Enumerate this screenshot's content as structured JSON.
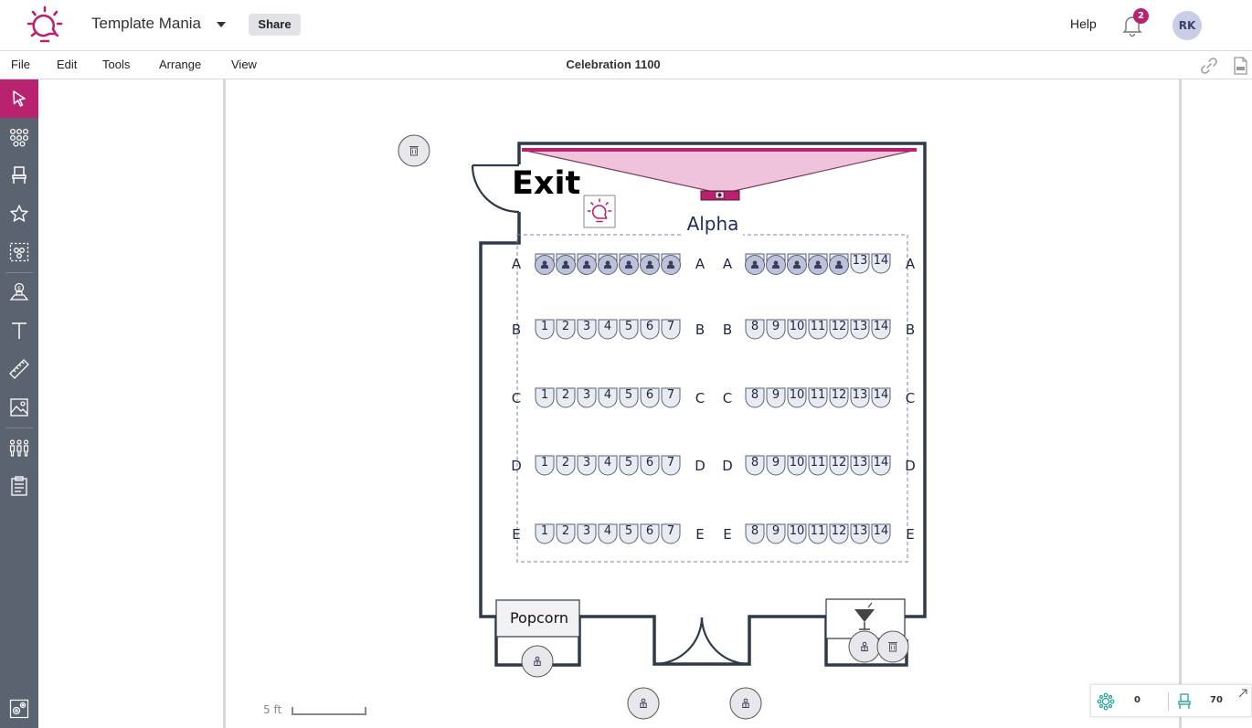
{
  "header": {
    "app_title": "Template Mania",
    "share_label": "Share",
    "help_label": "Help",
    "notification_count": "2",
    "avatar_initials": "RK"
  },
  "menu": {
    "items": [
      "File",
      "Edit",
      "Tools",
      "Arrange",
      "View"
    ],
    "document_title": "Celebration 1100"
  },
  "toolbar": {
    "tools": [
      "select-tool",
      "table-layout-tool",
      "chair-tool",
      "favorites-tool",
      "group-select-tool",
      "guest-marker-tool",
      "text-tool",
      "measure-tool",
      "image-tool",
      "attendees-tool",
      "clipboard-tool",
      "settings-tool"
    ]
  },
  "floorplan": {
    "exit_label": "Exit",
    "section_label": "Alpha",
    "popcorn_label": "Popcorn",
    "rows": [
      "A",
      "B",
      "C",
      "D",
      "E"
    ],
    "left_seats": [
      "1",
      "2",
      "3",
      "4",
      "5",
      "6",
      "7"
    ],
    "right_seats": [
      "8",
      "9",
      "10",
      "11",
      "12",
      "13",
      "14"
    ],
    "row_a_right_visible": [
      "13",
      "14"
    ],
    "occupied_left_row_a": 7,
    "occupied_right_row_a": 5,
    "scale_label": "5 ft"
  },
  "colors": {
    "accent": "#b8226e",
    "sidebar": "#5b6270",
    "seat_fill": "#e9ebf2",
    "seat_stroke": "#5a6076",
    "wall": "#2f3a48",
    "screen_fill": "#efc3dc",
    "section_dash": "#7e82a8"
  },
  "counter": {
    "staff_count": "0",
    "seat_count": "70"
  }
}
